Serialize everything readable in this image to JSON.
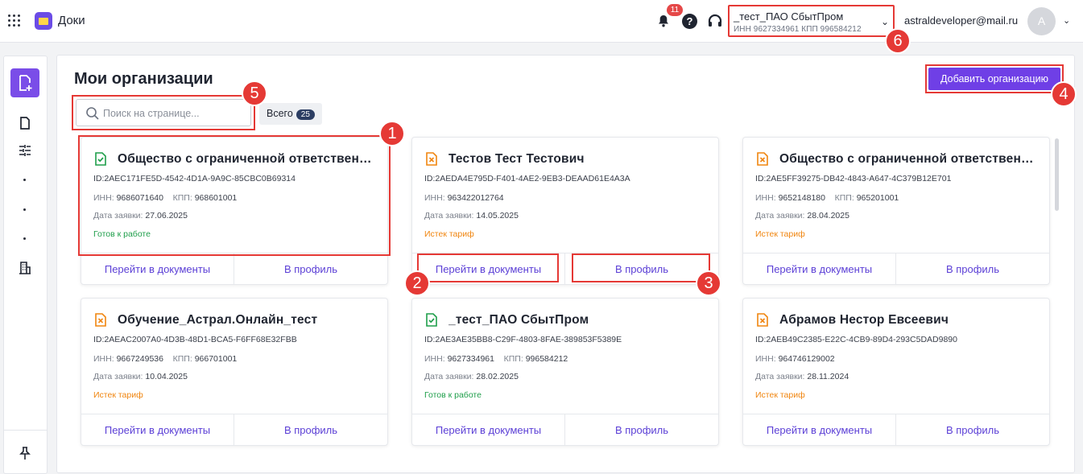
{
  "header": {
    "app_name": "Доки",
    "notifications_count": "11",
    "help_glyph": "?",
    "org_selector": {
      "name": "_тест_ПАО СбытПром",
      "details": "ИНН 9627334961   КПП 996584212"
    },
    "user_email": "astraldeveloper@mail.ru",
    "avatar_letter": "A"
  },
  "page": {
    "title": "Мои организации",
    "add_button_label": "Добавить организацию",
    "search_placeholder": "Поиск на странице...",
    "total_label": "Всего",
    "total_count": "25"
  },
  "card_actions": {
    "to_documents": "Перейти в документы",
    "to_profile": "В профиль"
  },
  "labels": {
    "inn": "ИНН:",
    "kpp": "КПП:",
    "date": "Дата заявки:"
  },
  "organizations": [
    {
      "name": "Общество с ограниченной ответственностью",
      "id": "ID:2AEC171FE5D-4542-4D1A-9A9C-85CBC0B69314",
      "inn": "9686071640",
      "kpp": "968601001",
      "date": "27.06.2025",
      "status": "Готов к работе",
      "status_type": "ready"
    },
    {
      "name": "Тестов Тест Тестович",
      "id": "ID:2AEDA4E795D-F401-4AE2-9EB3-DEAAD61E4A3A",
      "inn": "963422012764",
      "kpp": "",
      "date": "14.05.2025",
      "status": "Истек тариф",
      "status_type": "expired"
    },
    {
      "name": "Общество с ограниченной ответственностью",
      "id": "ID:2AE5FF39275-DB42-4843-A647-4C379B12E701",
      "inn": "9652148180",
      "kpp": "965201001",
      "date": "28.04.2025",
      "status": "Истек тариф",
      "status_type": "expired"
    },
    {
      "name": "Обучение_Астрал.Онлайн_тест",
      "id": "ID:2AEAC2007A0-4D3B-48D1-BCA5-F6FF68E32FBB",
      "inn": "9667249536",
      "kpp": "966701001",
      "date": "10.04.2025",
      "status": "Истек тариф",
      "status_type": "expired"
    },
    {
      "name": "_тест_ПАО СбытПром",
      "id": "ID:2AE3AE35BB8-C29F-4803-8FAE-389853F5389E",
      "inn": "9627334961",
      "kpp": "996584212",
      "date": "28.02.2025",
      "status": "Готов к работе",
      "status_type": "ready"
    },
    {
      "name": "Абрамов Нестор Евсеевич",
      "id": "ID:2AEB49C2385-E22C-4CB9-89D4-293C5DAD9890",
      "inn": "964746129002",
      "kpp": "",
      "date": "28.11.2024",
      "status": "Истек тариф",
      "status_type": "expired"
    }
  ],
  "annotations": [
    "1",
    "2",
    "3",
    "4",
    "5",
    "6"
  ],
  "colors": {
    "accent": "#6f3fe6",
    "highlight": "#e53935",
    "ready": "#1e9e4a",
    "expired": "#f0850f"
  }
}
